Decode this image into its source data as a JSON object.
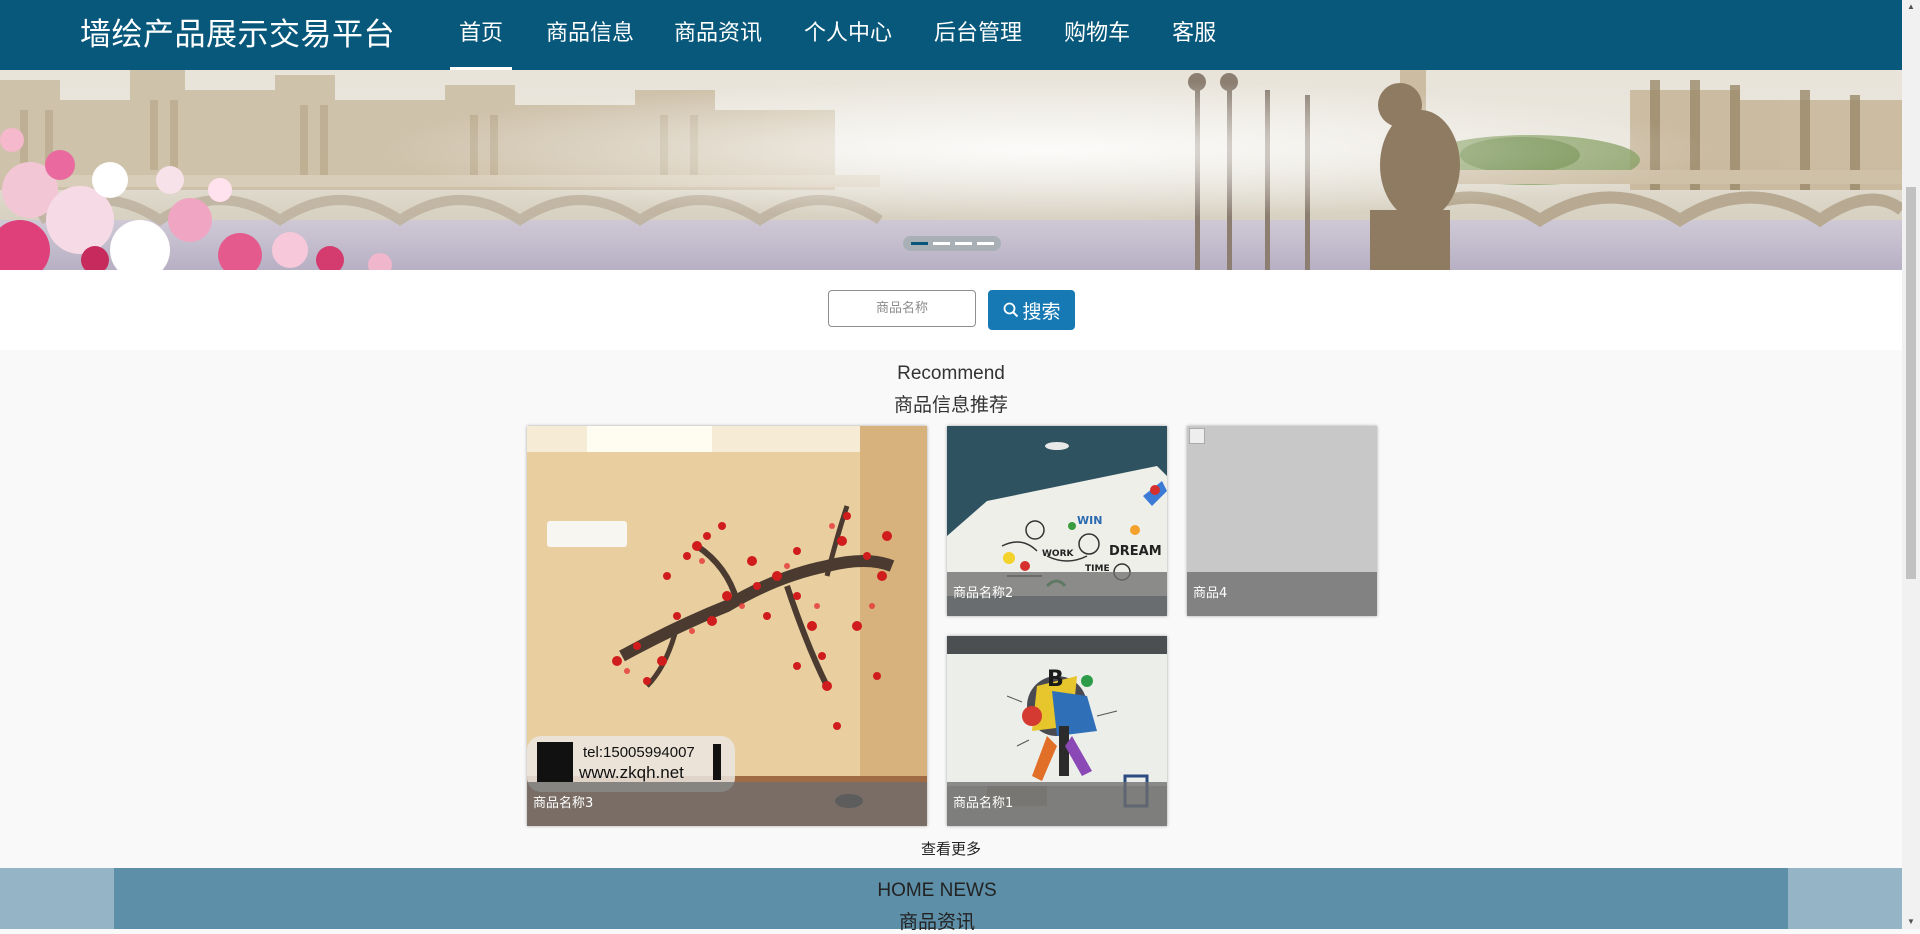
{
  "header": {
    "site_title": "墙绘产品展示交易平台",
    "nav": [
      {
        "label": "首页",
        "active": true
      },
      {
        "label": "商品信息",
        "active": false
      },
      {
        "label": "商品资讯",
        "active": false
      },
      {
        "label": "个人中心",
        "active": false
      },
      {
        "label": "后台管理",
        "active": false
      },
      {
        "label": "购物车",
        "active": false
      },
      {
        "label": "客服",
        "active": false
      }
    ]
  },
  "banner": {
    "slide_count": 4,
    "active_slide": 1
  },
  "search": {
    "placeholder": "商品名称",
    "value": "",
    "button_label": "搜索",
    "button_icon": "search-icon"
  },
  "recommend": {
    "title_en": "Recommend",
    "title_cn": "商品信息推荐",
    "items": [
      {
        "name": "商品名称3",
        "image": "plum-blossom-mural",
        "watermark_line1": "tel:15005994007",
        "watermark_line2": "www.zkqh.net"
      },
      {
        "name": "商品名称2",
        "image": "doodle-dream-mural"
      },
      {
        "name": "商品4",
        "image": "broken-image"
      },
      {
        "name": "商品名称1",
        "image": "graffiti-mural"
      }
    ],
    "more_label": "查看更多"
  },
  "news": {
    "title_en": "HOME NEWS",
    "title_cn": "商品资讯"
  },
  "colors": {
    "nav_bg": "#07587a",
    "search_button": "#1679b4",
    "news_bg": "#5e8fa8",
    "news_outer": "#95b5c7",
    "page_bg": "#f9f9f9"
  }
}
